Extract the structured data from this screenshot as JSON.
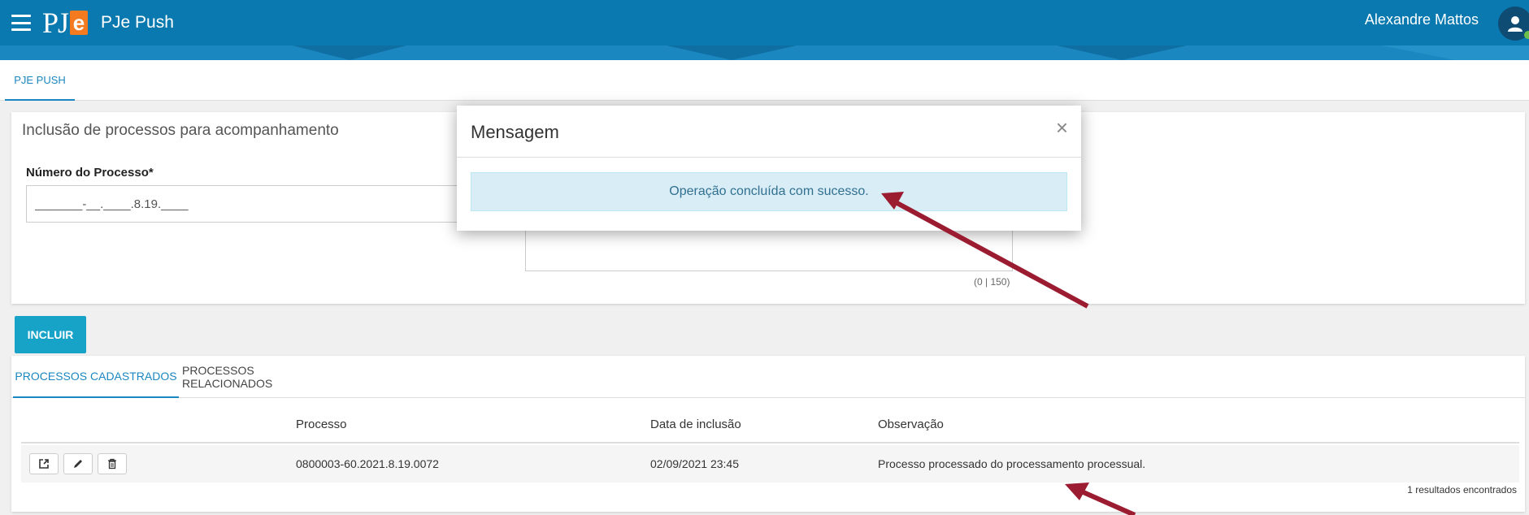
{
  "header": {
    "logo_pj": "PJ",
    "logo_e": "e",
    "app_title": "PJe Push",
    "user_name": "Alexandre Mattos"
  },
  "page_tabs": [
    {
      "label": "PJE PUSH"
    }
  ],
  "form": {
    "title": "Inclusão de processos para acompanhamento",
    "process_label": "Número do Processo*",
    "process_value": "_______-__.____.8.19.____",
    "char_counter": "(0 | 150)",
    "submit_label": "INCLUIR"
  },
  "list": {
    "tabs": [
      {
        "label": "PROCESSOS CADASTRADOS",
        "active": true
      },
      {
        "label": "PROCESSOS RELACIONADOS",
        "active": false
      }
    ],
    "columns": [
      "Processo",
      "Data de inclusão",
      "Observação"
    ],
    "rows": [
      {
        "processo": "0800003-60.2021.8.19.0072",
        "data_inclusao": "02/09/2021 23:45",
        "observacao": "Processo processado do processamento processual."
      }
    ],
    "results_text": "1 resultados encontrados"
  },
  "modal": {
    "title": "Mensagem",
    "close_glyph": "×",
    "message": "Operação concluída com sucesso."
  },
  "icons": [
    "menu-icon",
    "user-icon",
    "external-link-icon",
    "pencil-icon",
    "trash-icon",
    "close-icon"
  ],
  "colors": {
    "header": "#0a79b0",
    "accent": "#1b87c0",
    "button": "#17a2c8",
    "logo_e": "#f47a20",
    "alert_bg": "#d9edf7",
    "alert_text": "#31708f",
    "arrow": "#9b1b30"
  }
}
